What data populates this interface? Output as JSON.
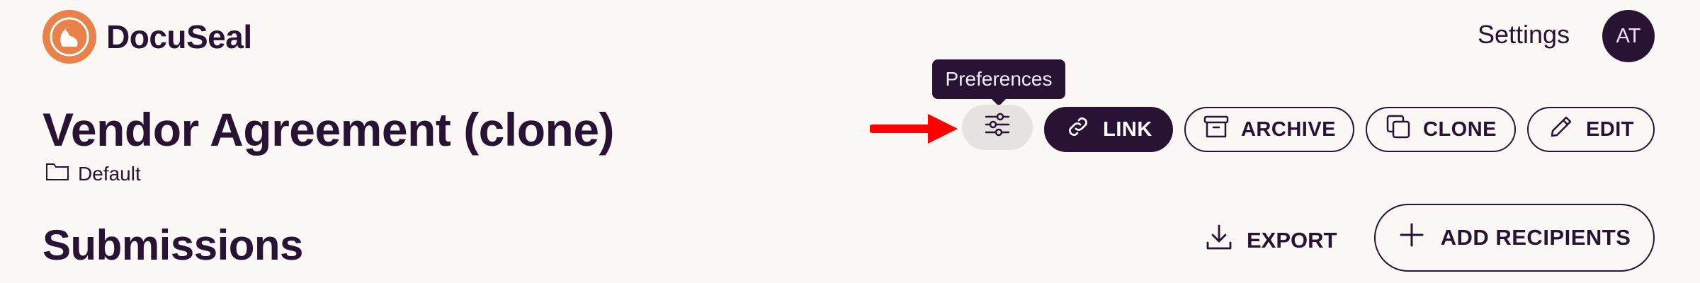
{
  "header": {
    "logo_text": "DocuSeal",
    "settings_label": "Settings",
    "avatar_initials": "AT"
  },
  "template": {
    "title": "Vendor Agreement (clone)",
    "folder": "Default"
  },
  "tooltip": {
    "text": "Preferences"
  },
  "actions": {
    "link_label": "LINK",
    "archive_label": "ARCHIVE",
    "clone_label": "CLONE",
    "edit_label": "EDIT"
  },
  "submissions": {
    "heading": "Submissions",
    "export_label": "EXPORT",
    "add_recipients_label": "ADD RECIPIENTS"
  },
  "colors": {
    "background": "#faf7f5",
    "primary": "#291334",
    "logo": "#e8824a",
    "annotation_arrow": "#ff0000"
  },
  "icons": [
    "docuseal-logo-icon",
    "folder-icon",
    "sliders-icon",
    "link-icon",
    "archive-icon",
    "clone-icon",
    "pencil-icon",
    "download-icon",
    "plus-icon",
    "red-arrow-annotation"
  ]
}
